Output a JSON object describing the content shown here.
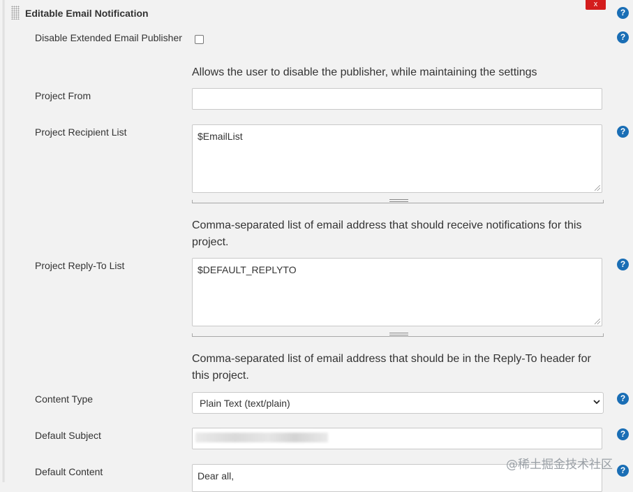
{
  "section": {
    "title": "Editable Email Notification",
    "close_label": "x"
  },
  "help_icon": "?",
  "fields": {
    "disable_publisher": {
      "label": "Disable Extended Email Publisher",
      "checked": false,
      "description": "Allows the user to disable the publisher, while maintaining the settings"
    },
    "project_from": {
      "label": "Project From",
      "value": ""
    },
    "recipient_list": {
      "label": "Project Recipient List",
      "value": "$EmailList",
      "description": "Comma-separated list of email address that should receive notifications for this project."
    },
    "reply_to_list": {
      "label": "Project Reply-To List",
      "value": "$DEFAULT_REPLYTO",
      "description": "Comma-separated list of email address that should be in the Reply-To header for this project."
    },
    "content_type": {
      "label": "Content Type",
      "selected": "Plain Text (text/plain)"
    },
    "default_subject": {
      "label": "Default Subject",
      "value": ""
    },
    "default_content": {
      "label": "Default Content",
      "value": "Dear all,"
    }
  },
  "watermark": "@稀土掘金技术社区",
  "colors": {
    "help": "#1a6eb5",
    "close": "#d41d1d",
    "background": "#f2f2f2"
  }
}
